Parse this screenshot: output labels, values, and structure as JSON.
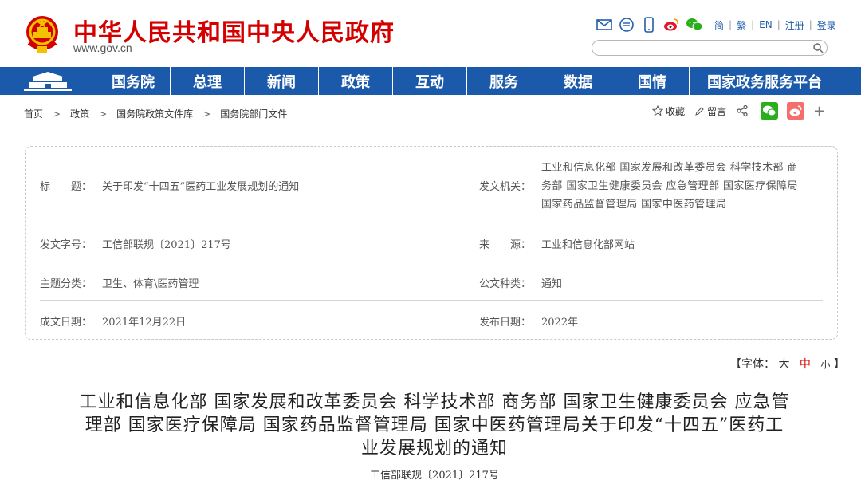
{
  "header": {
    "site_title": "中华人民共和国中央人民政府",
    "site_url": "www.gov.cn",
    "lang_links": [
      "简",
      "繁",
      "EN",
      "注册",
      "登录"
    ],
    "search_placeholder": ""
  },
  "nav": {
    "items": [
      "国务院",
      "总理",
      "新闻",
      "政策",
      "互动",
      "服务",
      "数据",
      "国情",
      "国家政务服务平台"
    ]
  },
  "breadcrumb": [
    "首页",
    "政策",
    "国务院政策文件库",
    "国务院部门文件"
  ],
  "tools": {
    "favorite": "收藏",
    "comment": "留言",
    "plus": "+"
  },
  "info": {
    "title_label": "标　　题：",
    "title_value": "关于印发“十四五”医药工业发展规划的通知",
    "issuer_label": "发文机关：",
    "issuer_lines": [
      "工业和信息化部 国家发展和改革委员会 科学技术部 商",
      "务部 国家卫生健康委员会 应急管理部 国家医疗保障局",
      "国家药品监督管理局 国家中医药管理局"
    ],
    "doc_no_label": "发文字号：",
    "doc_no_value": "工信部联规〔2021〕217号",
    "source_label": "来　　源：",
    "source_value": "工业和信息化部网站",
    "topic_label": "主题分类：",
    "topic_value": "卫生、体育\\医药管理",
    "type_label": "公文种类：",
    "type_value": "通知",
    "date_label": "成文日期：",
    "date_value": "2021年12月22日",
    "pub_label": "发布日期：",
    "pub_value": "2022年"
  },
  "font_size": {
    "prefix": "【字体：",
    "large": "大",
    "medium": "中",
    "small": "小",
    "suffix": "】"
  },
  "document": {
    "title_lines": [
      "工业和信息化部 国家发展和改革委员会 科学技术部 商务部 国家卫生健康委员会 应急管",
      "理部 国家医疗保障局 国家药品监督管理局 国家中医药管理局关于印发“十四五”医药工",
      "业发展规划的通知"
    ],
    "doc_number": "工信部联规〔2021〕217号"
  },
  "colors": {
    "brand_red": "#d40000",
    "nav_blue": "#1b5aab",
    "link_blue": "#1f5eaa"
  }
}
